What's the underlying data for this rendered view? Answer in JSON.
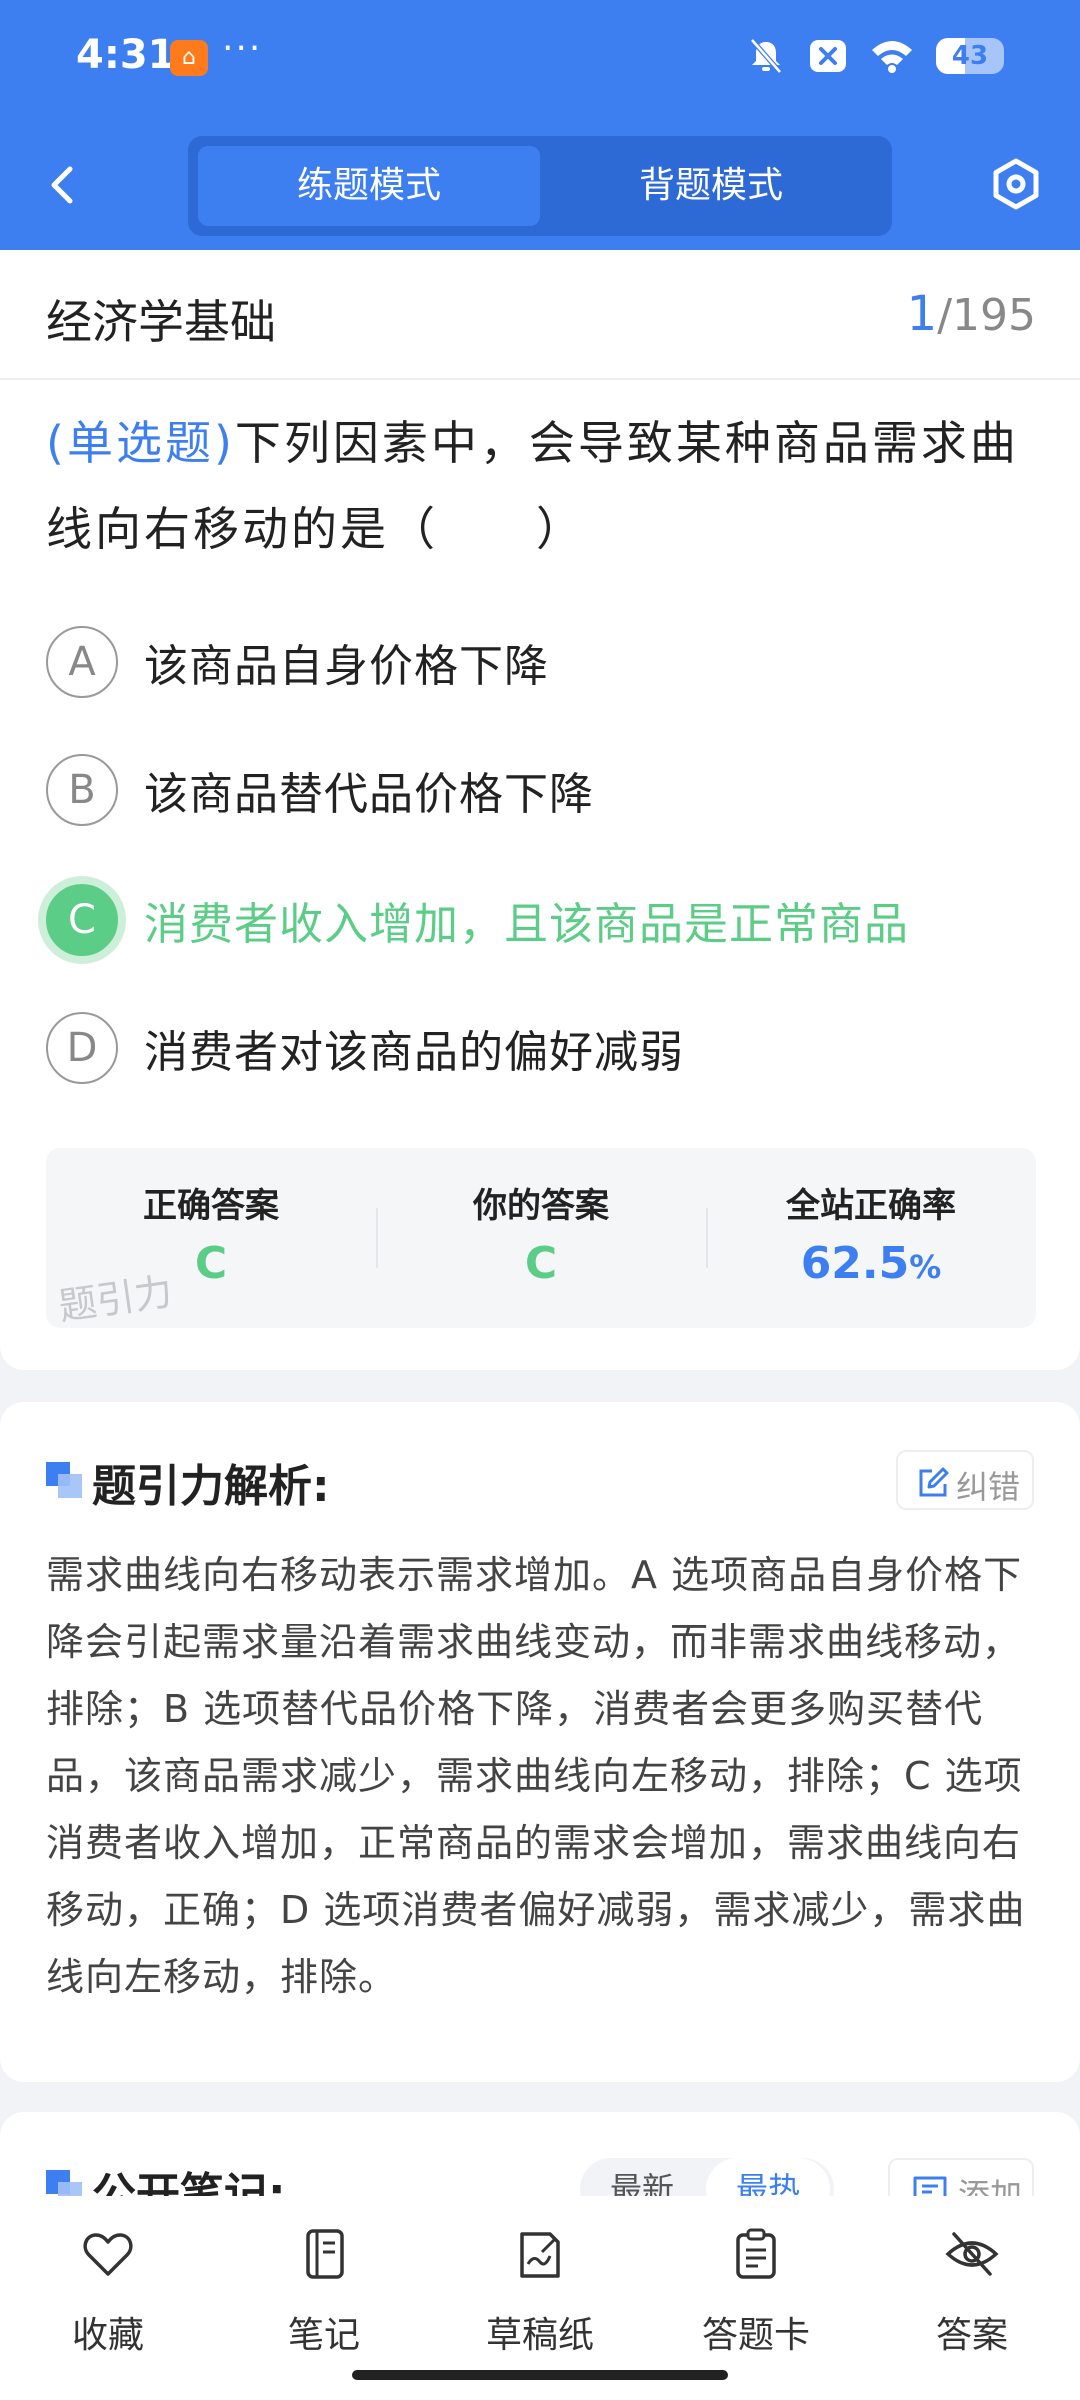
{
  "status_bar": {
    "time": "4:31",
    "more": "···",
    "battery": "43",
    "battery_level": 0.43
  },
  "header": {
    "mode_tabs": [
      "练题模式",
      "背题模式"
    ],
    "active_mode": 0
  },
  "subject": {
    "title": "经济学基础",
    "current": "1",
    "total": "/195"
  },
  "question": {
    "type": "(单选题)",
    "text": "下列因素中，会导致某种商品需求曲线向右移动的是（　　）",
    "options": [
      {
        "letter": "A",
        "text": "该商品自身价格下降"
      },
      {
        "letter": "B",
        "text": "该商品替代品价格下降"
      },
      {
        "letter": "C",
        "text": "消费者收入增加，且该商品是正常商品"
      },
      {
        "letter": "D",
        "text": "消费者对该商品的偏好减弱"
      }
    ]
  },
  "answer_panel": {
    "correct_label": "正确答案",
    "correct_value": "C",
    "yours_label": "你的答案",
    "yours_value": "C",
    "rate_label": "全站正确率",
    "rate_value": "62.5",
    "rate_unit": "%",
    "watermark": "题引力"
  },
  "analysis": {
    "title": "题引力解析:",
    "report_label": "纠错",
    "text": "需求曲线向右移动表示需求增加。A 选项商品自身价格下降会引起需求量沿着需求曲线变动，而非需求曲线移动，排除；B 选项替代品价格下降，消费者会更多购买替代品，该商品需求减少，需求曲线向左移动，排除；C 选项消费者收入增加，正常商品的需求会增加，需求曲线向右移动，正确；D 选项消费者偏好减弱，需求减少，需求曲线向左移动，排除。"
  },
  "notes": {
    "title": "公开笔记:",
    "sort_options": [
      "最新",
      "最热"
    ],
    "active_sort": 1,
    "add_label": "添加"
  },
  "bottom_nav": {
    "items": [
      {
        "label": "收藏",
        "icon": "heart-icon"
      },
      {
        "label": "笔记",
        "icon": "notebook-icon"
      },
      {
        "label": "草稿纸",
        "icon": "draft-icon"
      },
      {
        "label": "答题卡",
        "icon": "answer-card-icon"
      },
      {
        "label": "答案",
        "icon": "eye-off-icon"
      }
    ]
  },
  "colors": {
    "brand_blue": "#3d7ff0",
    "correct_green": "#5ccd87"
  }
}
